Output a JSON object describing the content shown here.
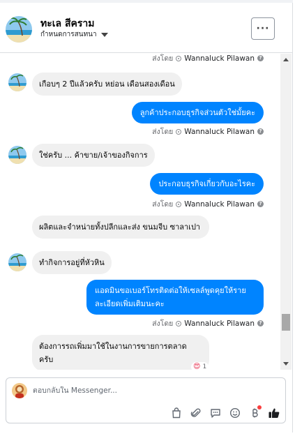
{
  "header": {
    "name": "ทะเล สีคราม",
    "assign_label": "กำหนดการสนทนา",
    "more_label": "···"
  },
  "messages": [
    {
      "side": "meta",
      "sent_by_label": "ส่งโดย",
      "sender": "Wannaluck Pilawan"
    },
    {
      "side": "in",
      "text": "เกือบๆ 2 ปีแล้วครับ หย่อน เดือนสองเดือน"
    },
    {
      "side": "out",
      "text": "ลูกค้าประกอบธุรกิจส่วนตัวใช่มั้ยคะ"
    },
    {
      "side": "meta",
      "sent_by_label": "ส่งโดย",
      "sender": "Wannaluck Pilawan"
    },
    {
      "side": "in",
      "text": "ใช่ครับ ... ค้าขาย/เจ้าของกิจการ"
    },
    {
      "side": "out",
      "text": "ประกอบธุรกิจเกี่ยวกับอะไรคะ"
    },
    {
      "side": "meta",
      "sent_by_label": "ส่งโดย",
      "sender": "Wannaluck Pilawan"
    },
    {
      "side": "in",
      "text": "ผลิตและจำหน่ายทั้งปลีกและส่ง ขนมจีบ ซาลาเปา"
    },
    {
      "side": "in",
      "text": "ทำกิจการอยู่ที่หัวหิน"
    },
    {
      "side": "out",
      "text": "แอดมินขอเบอร์โทรติดต่อให้เซลล์พูดคุยให้รายละเอียดเพิ่มเติมนะคะ"
    },
    {
      "side": "meta",
      "sent_by_label": "ส่งโดย",
      "sender": "Wannaluck Pilawan"
    },
    {
      "side": "in",
      "text": "ต้องการรถเพิ่มมาใช้ในงานการขายการตลาด ครับ",
      "reaction": "😍",
      "reaction_count": "1"
    }
  ],
  "composer": {
    "placeholder": "ตอบกลับใน Messenger...",
    "tools": [
      "shopping-bag-icon",
      "attachment-icon",
      "saved-reply-icon",
      "emoji-icon",
      "payment-icon",
      "like-icon"
    ]
  },
  "colors": {
    "outgoing_bubble": "#0084ff",
    "incoming_bubble": "#f0f0f0",
    "like": "#1c1e21"
  }
}
